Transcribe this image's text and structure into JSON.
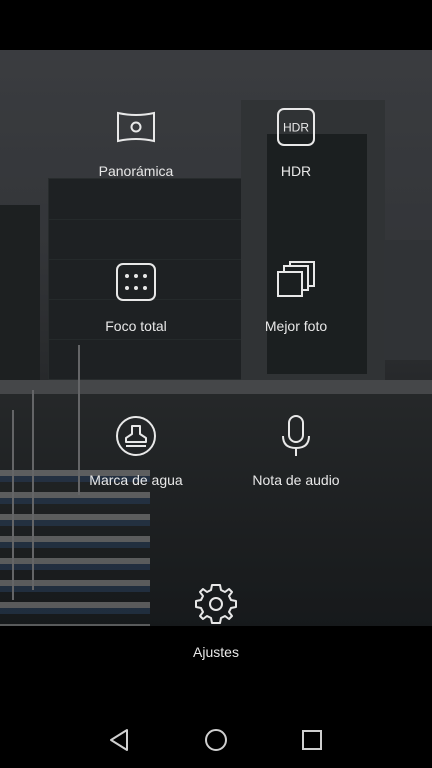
{
  "modes": [
    {
      "label": "Panorámica",
      "icon": "panorama-icon"
    },
    {
      "label": "HDR",
      "icon": "hdr-icon",
      "badge": "HDR"
    },
    {
      "label": "Foco total",
      "icon": "all-focus-icon"
    },
    {
      "label": "Mejor foto",
      "icon": "best-photo-icon"
    },
    {
      "label": "Marca de agua",
      "icon": "watermark-icon"
    },
    {
      "label": "Nota de audio",
      "icon": "microphone-icon"
    }
  ],
  "settings": {
    "label": "Ajustes",
    "icon": "gear-icon"
  },
  "navbar": {
    "back": "back-icon",
    "home": "home-icon",
    "recents": "recents-icon"
  },
  "colors": {
    "text": "#e8e8e8",
    "bar": "#000000"
  }
}
